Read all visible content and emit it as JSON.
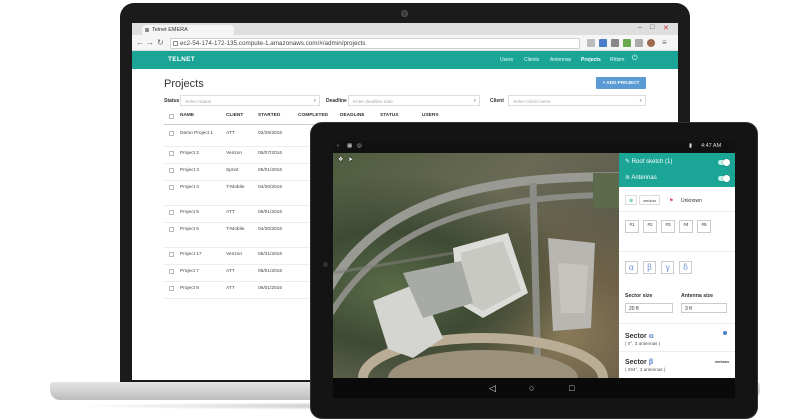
{
  "browser": {
    "tab_title": "Telnet EMERA",
    "url": "ec2-54-174-172-135.compute-1.amazonaws.com/#/admin/projects",
    "nav_back": "←",
    "nav_forward": "→",
    "nav_reload": "↻"
  },
  "app": {
    "brand": "TELNET",
    "nav": [
      "Users",
      "Clients",
      "Antennas",
      "Projects",
      "Rfdsm"
    ],
    "nav_active": "Projects",
    "page_title": "Projects",
    "add_button": "+ ADD PROJECT",
    "filters": {
      "status_label": "Status",
      "status_placeholder": "Select status",
      "deadline_label": "Deadline",
      "deadline_placeholder": "Enter deadline date",
      "client_label": "Client",
      "client_placeholder": "Select client name"
    },
    "columns": [
      "NAME",
      "CLIENT",
      "STARTED",
      "COMPLETED",
      "DEADLINE",
      "STATUS",
      "USERS"
    ],
    "rows": [
      {
        "name": "Demo Project 1",
        "client": "ATT",
        "started": "02/29/2016"
      },
      {
        "name": "Project 2",
        "client": "Verizon",
        "started": "05/07/2016"
      },
      {
        "name": "Project 3",
        "client": "Sprint",
        "started": "05/01/2016"
      },
      {
        "name": "Project 4",
        "client": "T-Mobile",
        "started": "04/30/2016"
      },
      {
        "name": "Project 5",
        "client": "ATT",
        "started": "05/01/2016"
      },
      {
        "name": "Project 6",
        "client": "T-Mobile",
        "started": "04/30/2016"
      },
      {
        "name": "Project 17",
        "client": "Verizon",
        "started": "05/31/2016"
      },
      {
        "name": "Project 7",
        "client": "ATT",
        "started": "06/01/2016"
      },
      {
        "name": "Project 8",
        "client": "ATT",
        "started": "06/01/2016"
      }
    ]
  },
  "tablet": {
    "time": "4:47 AM",
    "layers": [
      {
        "label": "Roof sketch (1)",
        "icon": "pencil-icon"
      },
      {
        "label": "Antennas",
        "icon": "wifi-icon"
      }
    ],
    "carrier_chip": "verizon",
    "unknown_chip": "Unknown",
    "antennas": [
      "#1",
      "#2",
      "#3",
      "#4",
      "#5"
    ],
    "greek": [
      "α",
      "β",
      "γ",
      "δ"
    ],
    "sector_size_label": "Sector size",
    "sector_size_value": "20 ft",
    "antenna_size_label": "Antenna size",
    "antenna_size_value": "3 ft",
    "sectors": [
      {
        "label": "Sector",
        "greek": "α",
        "sub": "( 0°, 3 antennas )"
      },
      {
        "label": "Sector",
        "greek": "β",
        "sub": "( 284°, 3 antennas )",
        "carrier": "verizon"
      }
    ],
    "accent": "#1aa597"
  }
}
